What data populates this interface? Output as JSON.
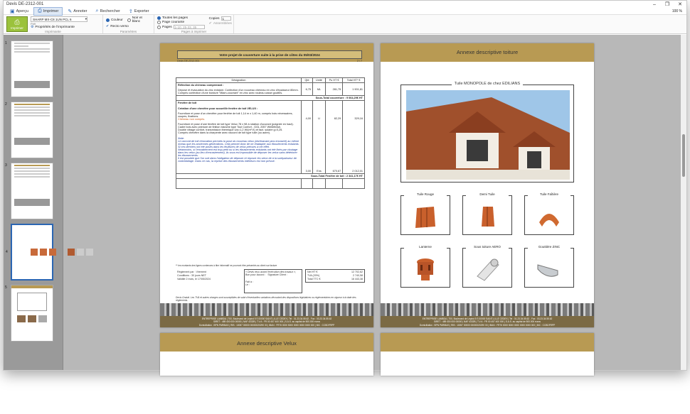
{
  "window": {
    "title": "Devis DE-2312-001",
    "zoom": "100 %"
  },
  "tabs": [
    {
      "label": "Aperçu",
      "icon": "preview-icon"
    },
    {
      "label": "Imprimer",
      "icon": "printer-icon"
    },
    {
      "label": "Annoter",
      "icon": "pen-icon"
    },
    {
      "label": "Rechercher",
      "icon": "search-icon"
    },
    {
      "label": "Exporter",
      "icon": "share-icon"
    }
  ],
  "ribbon": {
    "print_button": "Imprimer",
    "printer": "SHARP MX-C8 1UN PCL 6",
    "printer_status": "Prêt",
    "printer_props": "Propriétés de l'imprimante",
    "group_printer": "Imprimante",
    "color": "Couleur",
    "bw": "Noir et blanc",
    "duplex": "Recto verso",
    "group_params": "Paramètres",
    "all_pages": "Toutes les pages",
    "current_page": "Page courante",
    "pages": "Pages",
    "pages_placeholder": "1-10, 25-33, 35",
    "copies_label": "Copies",
    "copies_value": "1",
    "collate": "Assemblées",
    "group_pages": "Pages à imprimer"
  },
  "thumbs": [
    "1",
    "2",
    "3",
    "4",
    "5"
  ],
  "quote": {
    "title": "Votre projet de couverture suite à la prise de côtes du 05/03/2024",
    "ref_left": "Devis DE-2312-001",
    "ref_right": "2 / 7",
    "headers": [
      "Désignation",
      "Qté",
      "Unité",
      "Pu HT €",
      "Total HT* €"
    ],
    "s1_title": "Réfection du chéneau comprenant :",
    "s1_text": "Dépose et évacuation du zinc existant. Confection d'un nouveau chéneau en zinc d'épaisseur 80mm.\nCompris confection d'une bordure \"Miam-couvrant\" en zinc avec rouleau casse gouttes.",
    "s1_qty": "6,75",
    "s1_unit": "ML",
    "s1_pu": "281,75",
    "s1_total": "1 901,81",
    "s1_sub": "Sous-Total couverture : 9 064,29€ HT",
    "s2_title": "Fenêtre de toit",
    "s2_sub_title": "Création d'une chevêtre pour accueillir fenêtre de toit VELUX :",
    "s2_text": "Fourniture et pose d'un chevêtre pour fenêtre de toit 1,14 m x 1,40 m, compris bois nécessaires, coupes, fixations.",
    "s2_orange": "Chéneau non compris.",
    "s2_text2": "Fourniture et pose d'une fenêtre de toit type Velux 78 x 98 à rotation d'ouvrant (poignée en haut).\nCadre bois avec peinture de finition blanche type Tout Confort - GGL 2057 Whitefinish.\nDouble vitrage confort, transmission thermique Uw=1,2 W/(m².K) et fact. solaire g=0,25.\nCompris chevêtre dans la charpente avec raccord de toit type tuile (ou autre).",
    "s2_qty": "4,00",
    "s2_unit": "U",
    "s2_pu": "82,29",
    "s2_total": "329,16",
    "note_label": "Note:",
    "note": "Le raccord de toit rénovation permets la pose du nouveau velux (dorénavant plus encastré) au même niveau que les anciennes générations. Cela permet donc de ne réadapter aux éboulements existants.\nSi ces derniers ont été posés dans les feuillures de velux prévues à cet effet.\nNéanmoins, si l'encadrement est trop petit ou si les ébrasements existants ont été fixés par cloutage dans les velux (au lieu d'encastrement), ils vous est impossible de déposer les velux sans détériorer les ébrasements.\nIl est possible que l'on soit dans l'obligation de déposer et reposer les velux de à la surépaisseur de contrelattage. Dans ce cas, la reprise des ébrasements intérieurs est non prévue.",
    "s2b_qty": "3,00",
    "s2b_unit": "Ens",
    "s2b_pu": "670,67",
    "s2b_total": "2 012,01",
    "s2_sub": "Sous-Total Fenêtre de toit : 2 341,17€ HT",
    "footnote": "** les montants des lignes contenues à titre informatif ne pourront être présentés au client sur facture",
    "pay1": "Règlement par : Virement",
    "pay2": "Conditions : 30 jours NET",
    "pay3": "Validité 2 mois, le 17/05/2024",
    "sign1": "« Devis reçu avant l'exécution des travaux »,",
    "sign2": "Bon pour accord :",
    "sign3": "Signature Client :",
    "sign4": "Fait à :",
    "sign5": "Le :",
    "net_label": "Net HT €",
    "net": "12 702,62",
    "tva_label": "TVA (20%)",
    "tva": "2 740,58",
    "ttc_label": "Total TTC €",
    "ttc": "16 443,38",
    "footer_note": "Devis Gratuit. Les TVA et autres charges sont susceptibles de subir d'éventuelles variations découlant des dispositions législatives ou réglementaires en vigueur à la date des règlements.",
    "company": "ENTREPRISE LAMBDA | 700, Boulevard de Lepind 5 S 00000 SAINT-LILLE CEDEX | Tel : 01.23.34.55.62 - Fax : 03.23.34.55.62\nSIRET : 489 400 000 00000 | NAF 4332B | T.V.A : FR 00 457 400 000 | S.A.S. au capital de 500.000 euros\nDomiciliation : BPN PARIBAS | RIB : 10057 00000 00000020290 00 | IBAN : FR76 0000 5000 0000 0000 0000 000 | BIC : CCBDFRPP"
  },
  "annex": {
    "title": "Annexe descriptive toiture",
    "main_label": "Tuile MONOPOLE de chez EDILIANS",
    "products": [
      "Tuile Rouge",
      "Demi Tuile",
      "Tuile Faîtière",
      "Lanterne",
      "Sous toiture AERO",
      "Gouttière ZINC"
    ]
  },
  "next_page": {
    "title": "Annexe descriptive Velux"
  }
}
